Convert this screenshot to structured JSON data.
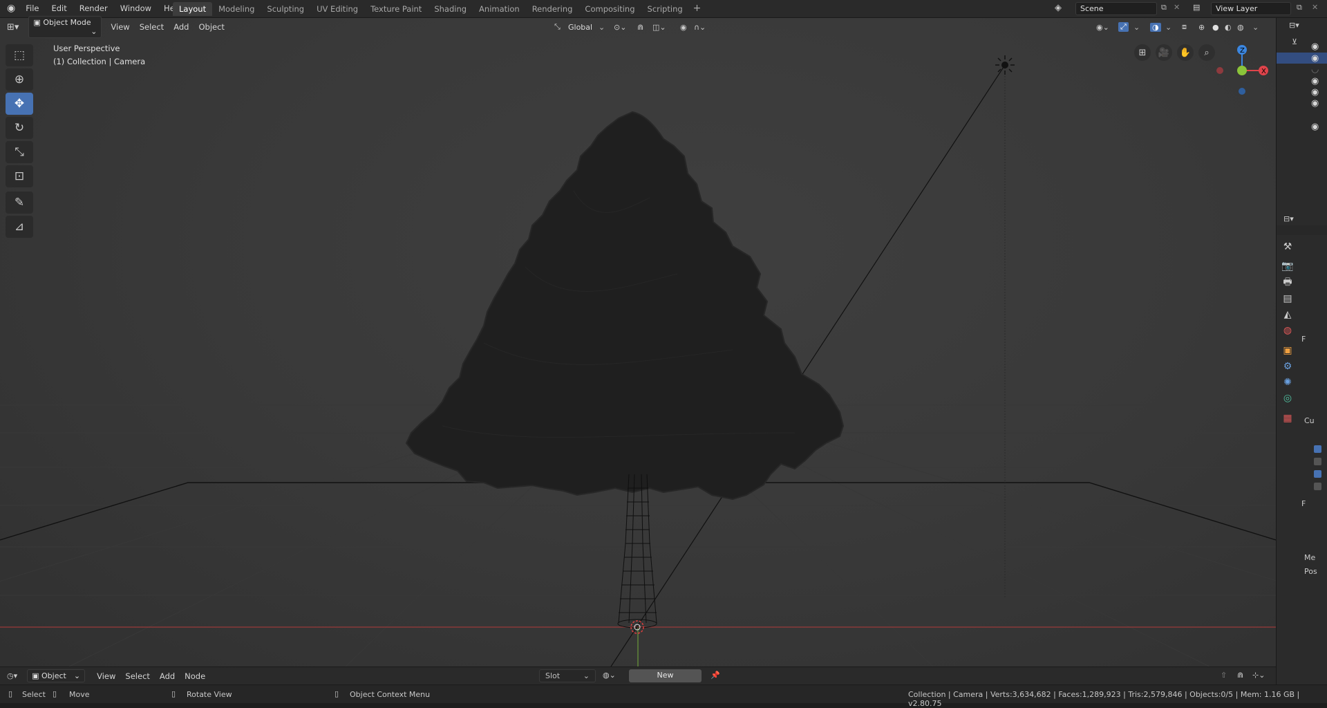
{
  "menu": {
    "items": [
      "File",
      "Edit",
      "Render",
      "Window",
      "Help"
    ]
  },
  "workspaces": {
    "tabs": [
      "Layout",
      "Modeling",
      "Sculpting",
      "UV Editing",
      "Texture Paint",
      "Shading",
      "Animation",
      "Rendering",
      "Compositing",
      "Scripting"
    ],
    "active": "Layout",
    "add": "+"
  },
  "scene": {
    "name": "Scene"
  },
  "view_layer": {
    "name": "View Layer"
  },
  "viewport_header": {
    "mode": "Object Mode",
    "menus": [
      "View",
      "Select",
      "Add",
      "Object"
    ],
    "orientation": "Global"
  },
  "viewport": {
    "perspective": "User Perspective",
    "context": "(1) Collection | Camera"
  },
  "gizmo": {
    "z": "Z",
    "y": "Y",
    "x": "X"
  },
  "toolbar": {
    "tools": [
      "select-box",
      "cursor",
      "move",
      "rotate",
      "scale",
      "transform",
      "annotate",
      "measure"
    ],
    "active": "move"
  },
  "bottom_header": {
    "editor": "Object",
    "menus": [
      "View",
      "Select",
      "Add",
      "Node"
    ],
    "slot": "Slot",
    "new_label": "New"
  },
  "statusbar": {
    "select": "Select",
    "move": "Move",
    "rotate": "Rotate View",
    "context": "Object Context Menu",
    "info": "Collection | Camera | Verts:3,634,682 | Faces:1,289,923 | Tris:2,579,846 | Objects:0/5 | Mem: 1.16 GB | v2.80.75"
  },
  "properties": {
    "labels": [
      "F",
      "F"
    ],
    "panel_labels": [
      "Cu",
      "Me",
      "Pos"
    ]
  },
  "colors": {
    "accent": "#4772b3",
    "x_axis": "#e0444b",
    "y_axis": "#8bc43a",
    "z_axis": "#3b86e0"
  }
}
